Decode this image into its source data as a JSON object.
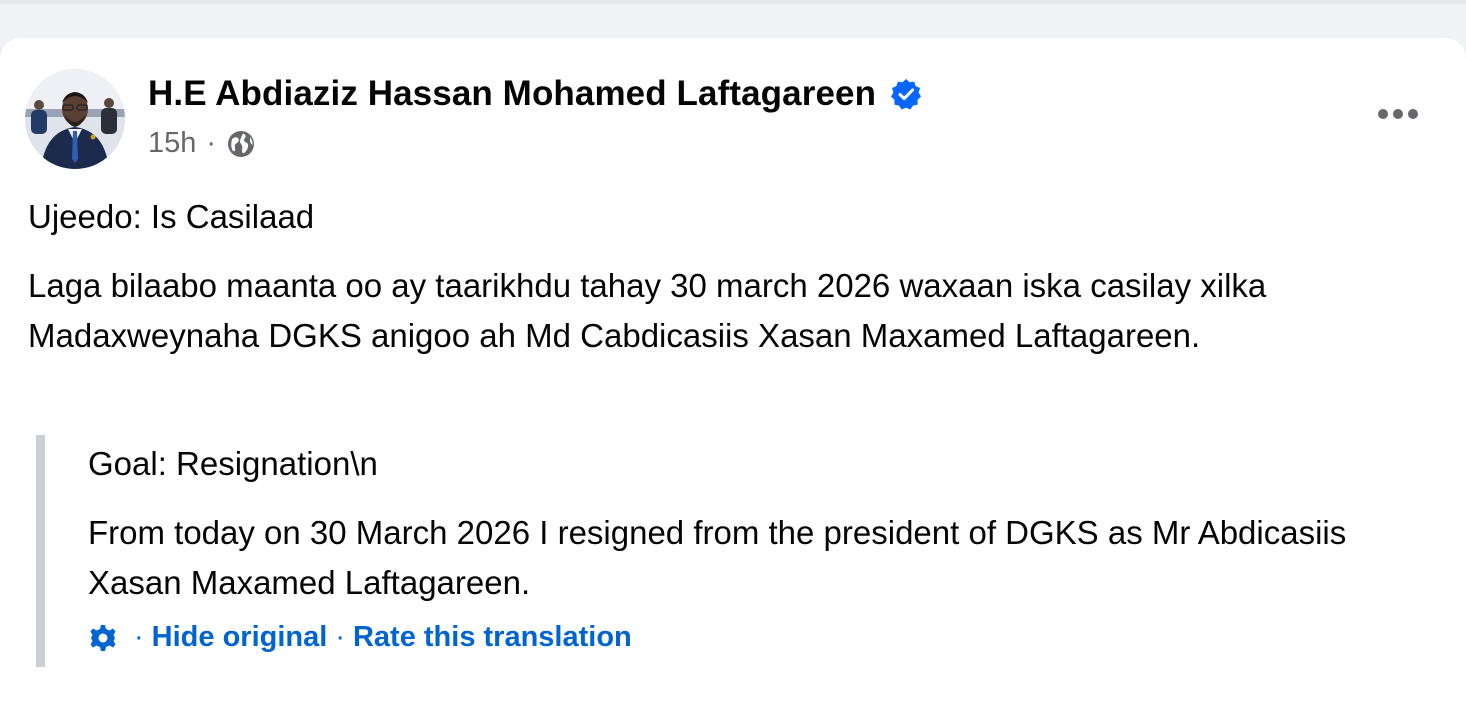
{
  "post": {
    "author": "H.E Abdiaziz Hassan Mohamed Laftagareen",
    "time": "15h",
    "separator": "·",
    "body": {
      "subject": "Ujeedo: Is Casilaad",
      "text": "Laga bilaabo maanta oo ay taarikhdu tahay 30 march 2026 waxaan iska casilay xilka Madaxweynaha DGKS anigoo ah Md Cabdicasiis Xasan Maxamed Laftagareen."
    },
    "translation": {
      "subject": "Goal: Resignation\\n",
      "text": "From today on 30 March 2026 I resigned from the president of DGKS as Mr Abdicasiis Xasan Maxamed Laftagareen.",
      "separator_1": "·",
      "hide_original": "Hide original",
      "separator_2": "·",
      "rate": "Rate this translation"
    }
  },
  "icons": {
    "verified": "verified-badge-icon",
    "audience": "globe-icon",
    "more": "more-options-icon",
    "translate_settings": "gear-icon"
  },
  "colors": {
    "link": "#0064d1",
    "verified": "#0866ff",
    "secondary_text": "#65676b",
    "quote_bar": "#ccd0d5",
    "page_bg": "#f0f2f5"
  }
}
